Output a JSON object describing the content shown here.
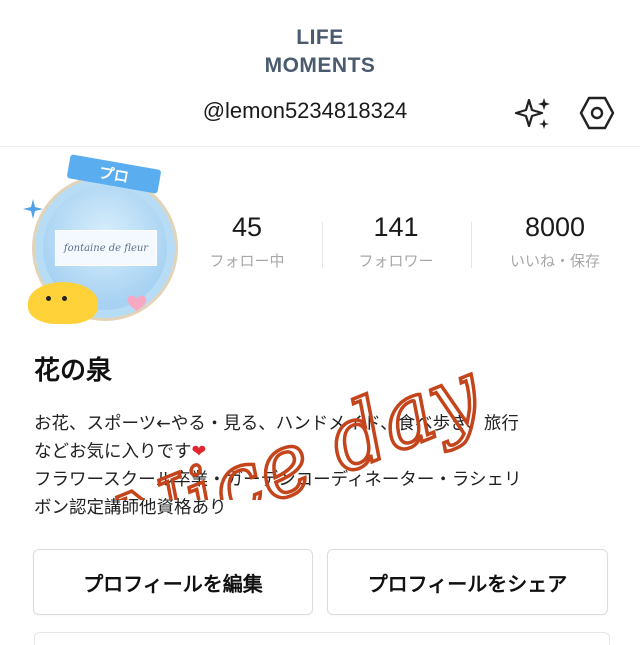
{
  "header": {
    "brand_line1": "LIFE",
    "brand_line2": "MOMENTS",
    "handle": "@lemon5234818324",
    "actions": [
      {
        "icon": "sparkles-icon"
      },
      {
        "icon": "settings-hexagon-icon"
      }
    ]
  },
  "avatar": {
    "badge": "プロ",
    "plaque_text": "fontaine de fleur"
  },
  "stats": [
    {
      "value": "45",
      "label": "フォロー中"
    },
    {
      "value": "141",
      "label": "フォロワー"
    },
    {
      "value": "8000",
      "label": "いいね・保存"
    }
  ],
  "profile": {
    "name": "花の泉",
    "bio_line1": "お花、スポーツ←やる・見る、ハンドメイド、食べ歩き、旅行",
    "bio_line2_text": "などお気に入りです",
    "bio_line2_emoji": "❤",
    "bio_line3": "フラワースクール卒業・ガーデンコーディネーター・ラシェリ",
    "bio_line4": "ボン認定講師他資格あり"
  },
  "buttons": {
    "edit_profile": "プロフィールを編集",
    "share_profile": "プロフィールをシェア"
  },
  "overlay_text": "Nice day",
  "colors": {
    "brand": "#4a5b70",
    "overlay": "#c4451c",
    "heart": "#e0252e",
    "muted": "#a8a8a8"
  }
}
